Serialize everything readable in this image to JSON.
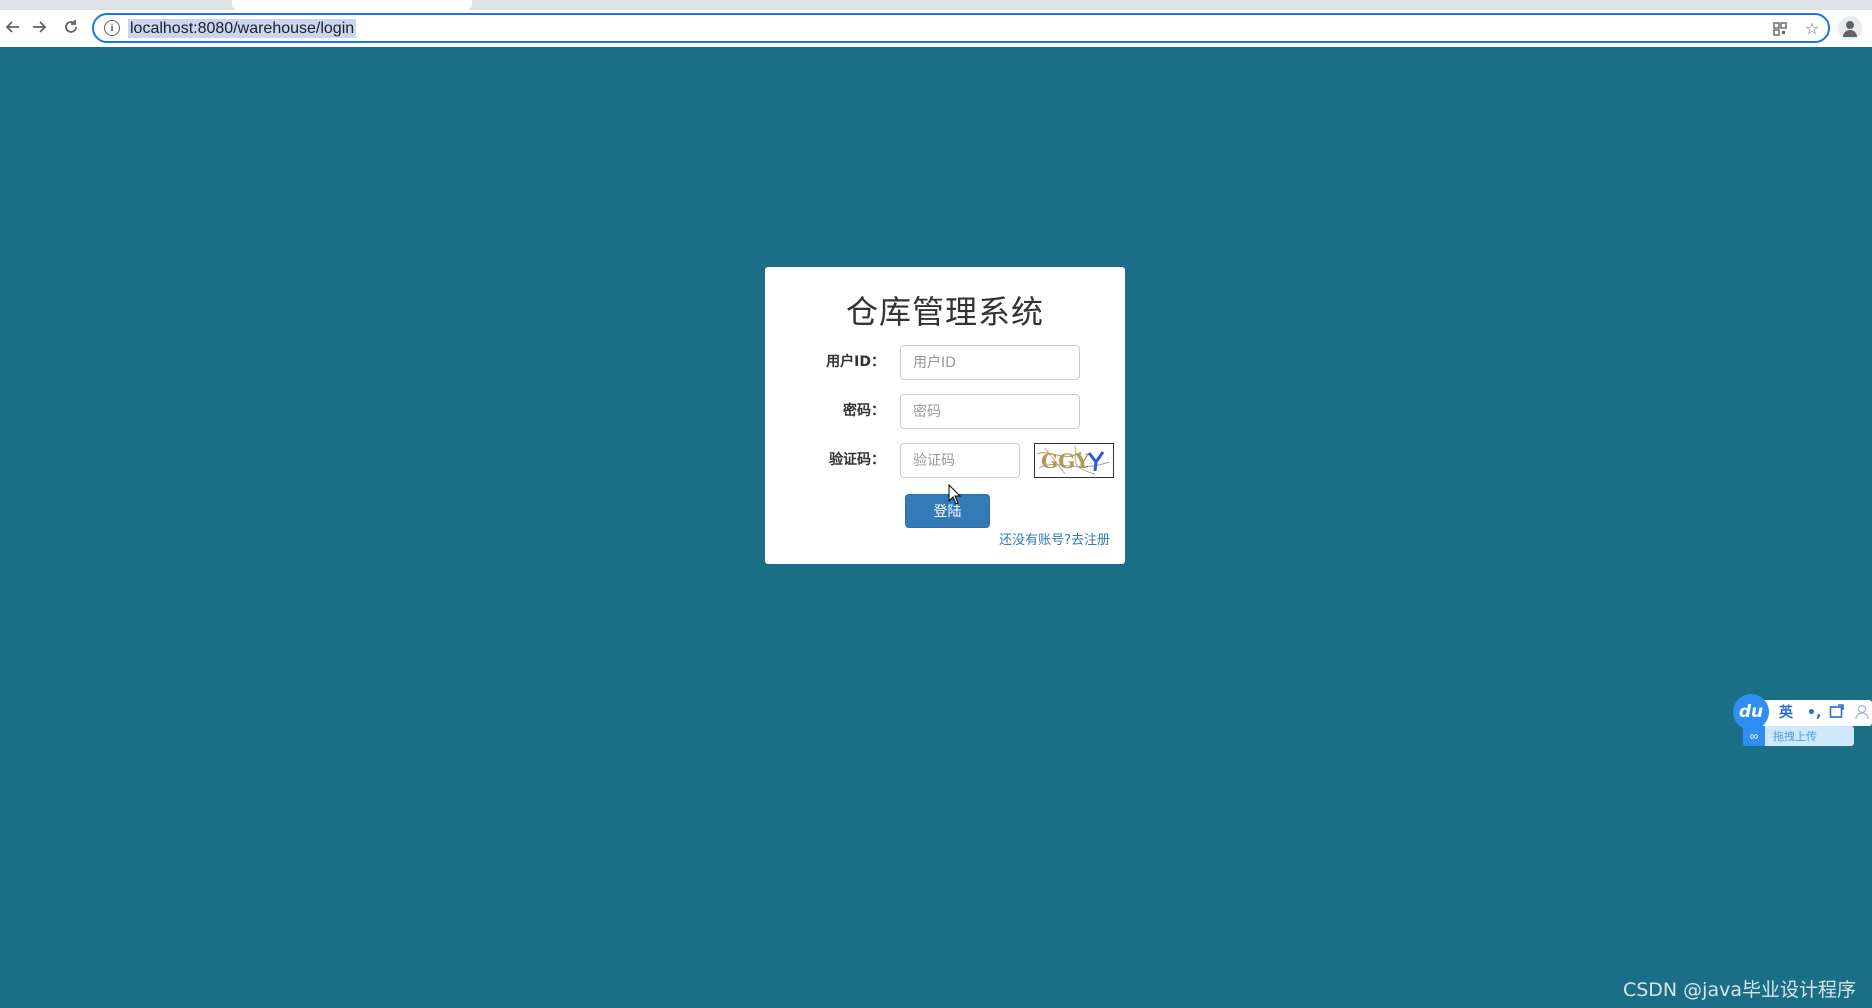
{
  "browser": {
    "url": "localhost:8080/warehouse/login"
  },
  "login": {
    "title": "仓库管理系统",
    "user_id_label": "用户ID：",
    "user_id_placeholder": "用户ID",
    "password_label": "密码：",
    "password_placeholder": "密码",
    "captcha_label": "验证码：",
    "captcha_placeholder": "验证码",
    "captcha_text": "GGY",
    "login_button": "登陆",
    "register_link": "还没有账号?去注册"
  },
  "ime": {
    "logo": "du",
    "mode": "英",
    "punct": "•,",
    "upload_label": "拖拽上传"
  },
  "watermark": "CSDN @java毕业设计程序",
  "colors": {
    "page_background": "#1c6e87",
    "primary_button": "#337ab7",
    "link": "#337ab7"
  }
}
